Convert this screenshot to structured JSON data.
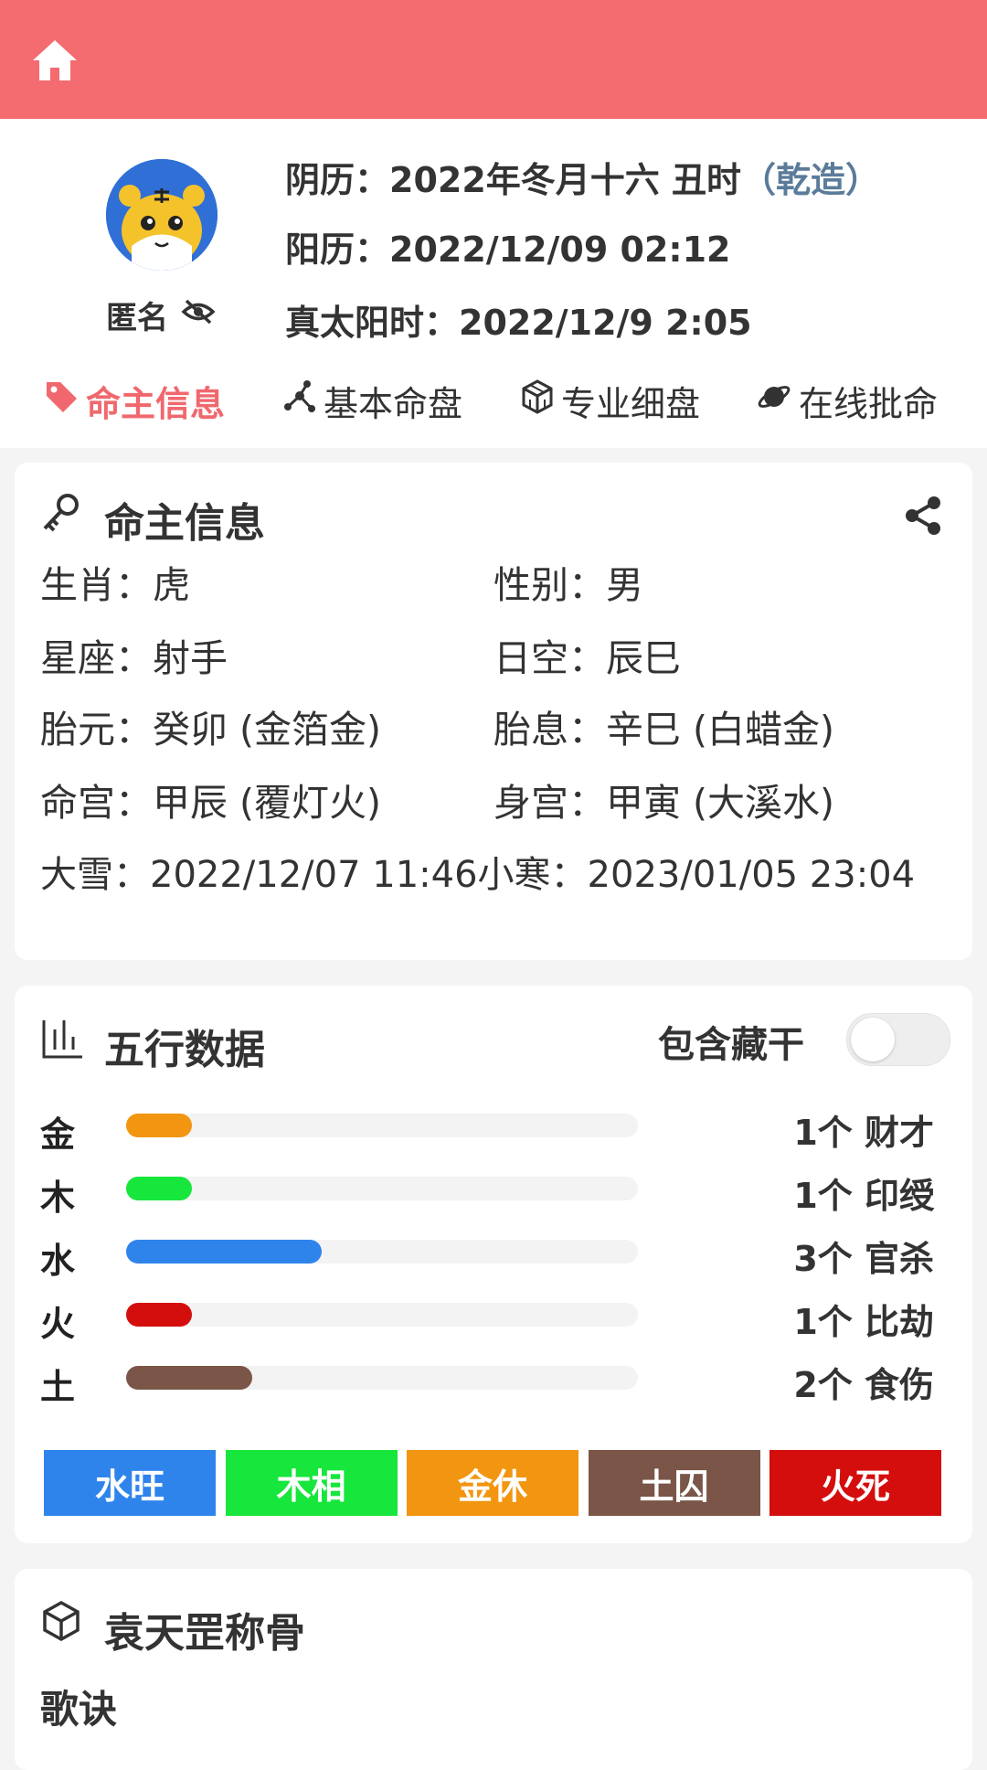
{
  "profile": {
    "anonymous_label": "匿名",
    "lunar_prefix": "阴历：2022年冬月十六 丑时",
    "lunar_gender": "（乾造）",
    "solar": "阳历：2022/12/09 02:12",
    "true_solar": "真太阳时：2022/12/9 2:05"
  },
  "tabs": [
    {
      "label": "命主信息",
      "icon": "tag-icon",
      "active": true
    },
    {
      "label": "基本命盘",
      "icon": "nodes-icon",
      "active": false
    },
    {
      "label": "专业细盘",
      "icon": "cubes-icon",
      "active": false
    },
    {
      "label": "在线批命",
      "icon": "planet-icon",
      "active": false
    }
  ],
  "owner_info": {
    "title": "命主信息",
    "rows": [
      [
        "生肖：虎",
        "性别：男"
      ],
      [
        "星座：射手",
        "日空：辰巳"
      ],
      [
        "胎元：癸卯 (金箔金)",
        "胎息：辛巳 (白蜡金)"
      ],
      [
        "命宫：甲辰 (覆灯火)",
        "身宫：甲寅 (大溪水)"
      ]
    ],
    "terms": [
      "大雪：2022/12/07 11:46",
      "小寒：2023/01/05 23:04"
    ]
  },
  "five_elements": {
    "title": "五行数据",
    "toggle_label": "包含藏干",
    "toggle_on": false,
    "items": [
      {
        "name": "金",
        "count": 1,
        "text": "1个 财才",
        "color": "#f29510"
      },
      {
        "name": "木",
        "count": 1,
        "text": "1个 印绶",
        "color": "#17e63c"
      },
      {
        "name": "水",
        "count": 3,
        "text": "3个 官杀",
        "color": "#2f84ec"
      },
      {
        "name": "火",
        "count": 1,
        "text": "1个 比劫",
        "color": "#d40d0d"
      },
      {
        "name": "土",
        "count": 2,
        "text": "2个 食伤",
        "color": "#7a5548"
      }
    ],
    "states": [
      {
        "label": "水旺",
        "color": "#2f84ec"
      },
      {
        "label": "木相",
        "color": "#17e63c"
      },
      {
        "label": "金休",
        "color": "#f29510"
      },
      {
        "label": "土囚",
        "color": "#7a5548"
      },
      {
        "label": "火死",
        "color": "#d40d0d"
      }
    ]
  },
  "bone_weight": {
    "title": "袁天罡称骨",
    "subtitle": "歌诀"
  }
}
